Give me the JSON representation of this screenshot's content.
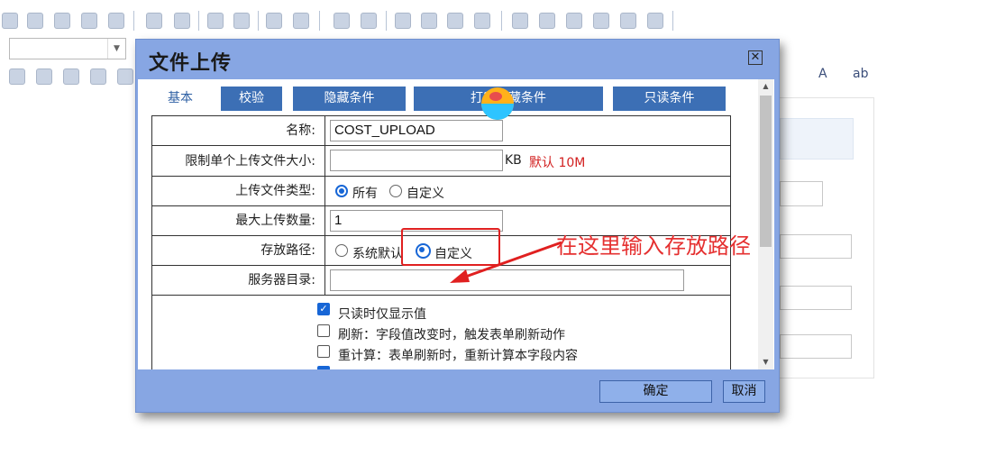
{
  "dialog": {
    "title": "文件上传",
    "close_glyph": "✕",
    "tabs": [
      {
        "label": "基本"
      },
      {
        "label": "校验"
      },
      {
        "label": "隐藏条件"
      },
      {
        "label": "打印隐藏条件"
      },
      {
        "label": "只读条件"
      }
    ],
    "form": {
      "name_label": "名称:",
      "name_value": "COST_UPLOAD",
      "size_label": "限制单个上传文件大小:",
      "size_value": "",
      "size_unit": "KB",
      "size_default": "默认 10M",
      "type_label": "上传文件类型:",
      "type_opt_all": "所有",
      "type_opt_custom": "自定义",
      "max_label": "最大上传数量:",
      "max_value": "1",
      "path_label": "存放路径:",
      "path_opt_system": "系统默认",
      "path_opt_custom": "自定义",
      "server_dir_label": "服务器目录:",
      "server_dir_value": "",
      "options": [
        {
          "label": "只读时仅显示值",
          "checked": true
        },
        {
          "label": "刷新：字段值改变时，触发表单刷新动作",
          "checked": false
        },
        {
          "label": "重计算：表单刷新时，重新计算本字段内容",
          "checked": false
        }
      ]
    },
    "ok_label": "确定",
    "cancel_label": "取消"
  },
  "annotation": {
    "text": "在这里输入存放路径",
    "color": "#e53030"
  },
  "toolbar": {
    "right_icon_1": "A",
    "right_icon_2": "ab"
  },
  "colors": {
    "dialog_bg": "#87a6e3",
    "tab_bg": "#3c6fb5",
    "radio_accent": "#1766d6"
  }
}
